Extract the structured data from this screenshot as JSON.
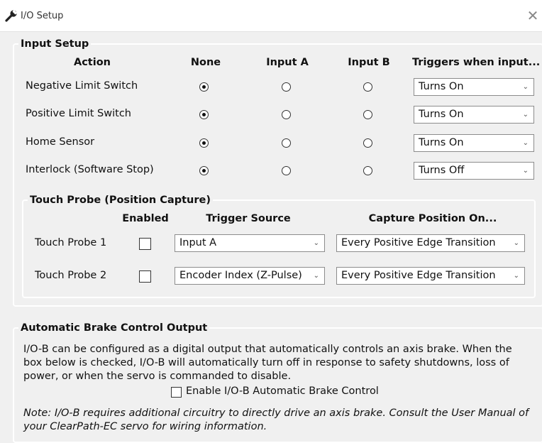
{
  "window": {
    "title": "I/O Setup",
    "title_icon": "wrench-icon",
    "close_glyph": "✕"
  },
  "input_setup": {
    "legend": "Input Setup",
    "headers": {
      "action": "Action",
      "none": "None",
      "input_a": "Input A",
      "input_b": "Input B",
      "triggers": "Triggers when input..."
    },
    "rows": [
      {
        "action": "Negative Limit Switch",
        "selected": "none",
        "trigger": "Turns On"
      },
      {
        "action": "Positive Limit Switch",
        "selected": "none",
        "trigger": "Turns On"
      },
      {
        "action": "Home Sensor",
        "selected": "none",
        "trigger": "Turns On"
      },
      {
        "action": "Interlock (Software Stop)",
        "selected": "none",
        "trigger": "Turns Off"
      }
    ]
  },
  "touch_probe": {
    "legend": "Touch Probe (Position Capture)",
    "headers": {
      "enabled": "Enabled",
      "trigger_source": "Trigger Source",
      "capture_position": "Capture Position On..."
    },
    "rows": [
      {
        "label": "Touch Probe 1",
        "enabled": false,
        "trigger_source": "Input A",
        "capture_on": "Every Positive Edge Transition"
      },
      {
        "label": "Touch Probe 2",
        "enabled": false,
        "trigger_source": "Encoder Index (Z-Pulse)",
        "capture_on": "Every Positive Edge Transition"
      }
    ]
  },
  "brake": {
    "legend": "Automatic Brake Control Output",
    "description_lines": [
      "I/O-B can be configured as a digital output that automatically controls an axis brake. When the",
      "box below is checked, I/O-B will automatically turn off in response to safety shutdowns, loss of",
      "power, or when the servo is commanded to disable."
    ],
    "checkbox_label": "Enable I/O-B Automatic Brake Control",
    "checkbox_checked": false,
    "note_lines": [
      "Note: I/O-B requires additional circuitry to directly drive an axis brake. Consult the User Manual of",
      "your ClearPath-EC servo for wiring information."
    ]
  }
}
